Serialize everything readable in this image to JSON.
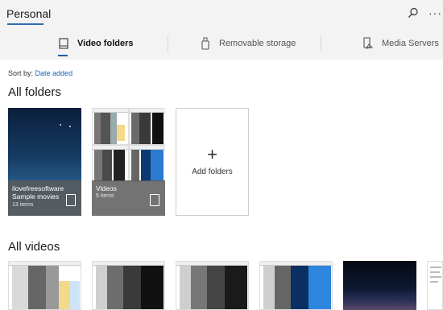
{
  "header": {
    "title": "Personal",
    "search_icon": "search-icon",
    "more_label": "···"
  },
  "nav": {
    "items": [
      {
        "label": "Video folders",
        "icon": "video-folder-icon",
        "active": true
      },
      {
        "label": "Removable storage",
        "icon": "usb-drive-icon",
        "active": false
      },
      {
        "label": "Media Servers",
        "icon": "media-server-icon",
        "active": false
      }
    ]
  },
  "sort": {
    "label": "Sort by:",
    "value": "Date added"
  },
  "sections": {
    "folders_title": "All folders",
    "videos_title": "All videos"
  },
  "folders": [
    {
      "name": "ilovefreesoftware Sample movies",
      "count": "13 items"
    },
    {
      "name": "Videos",
      "count": "5 items"
    }
  ],
  "add_folder": {
    "plus": "+",
    "label": "Add folders"
  },
  "colors": {
    "accent": "#0b5cad",
    "link": "#1565c0",
    "bar": "#f3f3f3"
  }
}
